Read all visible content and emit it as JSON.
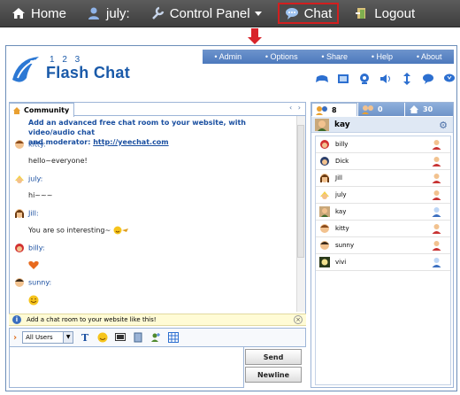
{
  "nav": {
    "home": "Home",
    "user": "july:",
    "control_panel": "Control Panel",
    "chat": "Chat",
    "logout": "Logout"
  },
  "logo": {
    "numbers": "1 2 3",
    "title": "Flash Chat"
  },
  "menu": [
    "Admin",
    "Options",
    "Share",
    "Help",
    "About"
  ],
  "chat": {
    "tab_label": "Community",
    "intro_line1": "Add an advanced free chat room to your website, with video/audio chat",
    "intro_line2": "and moderator: ",
    "intro_link": "http://yeechat.com",
    "messages": [
      {
        "name": "kitty:",
        "text": "hello~everyone!"
      },
      {
        "name": "july:",
        "text": "hi~~~"
      },
      {
        "name": "Jill:",
        "text": "You are so interesting~"
      },
      {
        "name": "billy:",
        "text": ""
      },
      {
        "name": "sunny:",
        "text": ""
      }
    ],
    "notice": "Add a chat room to your website like this!",
    "recipient": "All Users",
    "send_label": "Send",
    "newline_label": "Newline"
  },
  "users": {
    "tabs": [
      {
        "count": "8"
      },
      {
        "count": "0"
      },
      {
        "count": "30"
      }
    ],
    "me": "kay",
    "list": [
      {
        "name": "billy",
        "gender": "male"
      },
      {
        "name": "Dick",
        "gender": "male"
      },
      {
        "name": "Jill",
        "gender": "female"
      },
      {
        "name": "july",
        "gender": "female"
      },
      {
        "name": "kay",
        "gender": "male-blue"
      },
      {
        "name": "kitty",
        "gender": "female"
      },
      {
        "name": "sunny",
        "gender": "female"
      },
      {
        "name": "vivi",
        "gender": "male-blue"
      }
    ]
  },
  "colors": {
    "accent": "#1a5aa9",
    "nav_bg": "#4a4a4a",
    "highlight": "#d21f1f",
    "menubar": "#5a84c4"
  }
}
